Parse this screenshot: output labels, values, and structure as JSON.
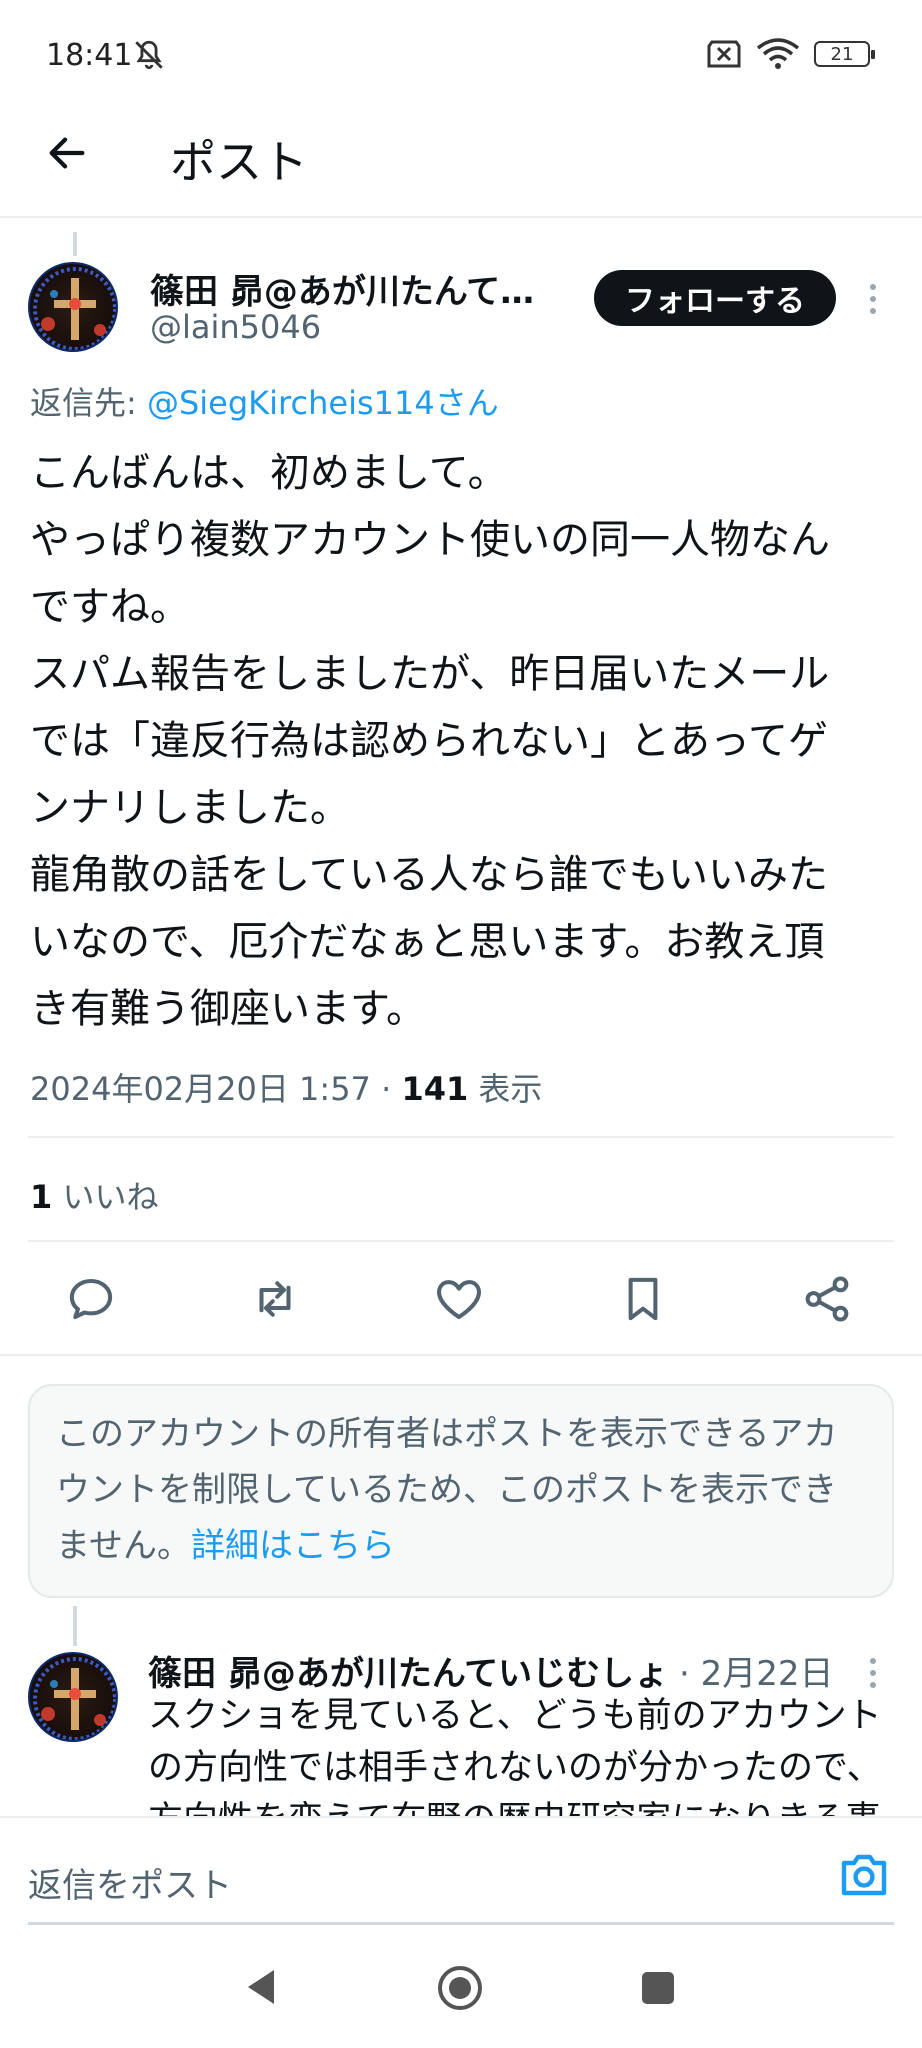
{
  "status_bar": {
    "time": "18:41",
    "battery": "21"
  },
  "header": {
    "title": "ポスト"
  },
  "post": {
    "display_name": "篠田 昴@あが川たんて…",
    "handle": "@lain5046",
    "follow_label": "フォローする",
    "reply_to_prefix": "返信先: ",
    "reply_to_target": "@SiegKircheis114さん",
    "body_lines": [
      "こんばんは、初めまして。",
      "やっぱり複数アカウント使いの同一人物なん",
      "ですね。",
      "スパム報告をしましたが、昨日届いたメール",
      "では「違反行為は認められない」とあってゲ",
      "ンナリしました。",
      "龍角散の話をしている人なら誰でもいいみた",
      "いなので、厄介だなぁと思います。お教え頂",
      "き有難う御座います。"
    ],
    "timestamp": "2024年02月20日 1:57",
    "separator": " · ",
    "views_count": "141",
    "views_label": " 表示",
    "likes_count": "1",
    "likes_label": " いいね"
  },
  "restricted_notice": {
    "text": "このアカウントの所有者はポストを表示できるアカウントを制限しているため、このポストを表示できません。",
    "link": "詳細はこちら"
  },
  "reply": {
    "display_name": "篠田 昴@あが川たんていじむしょ",
    "date": " · 2月22日",
    "lines": [
      "スクショを見ていると、どうも前のアカウント",
      "の方向性では相手されないのが分かったので、",
      "方向性を変えて在野の歴史研究家になりきる事"
    ]
  },
  "composer": {
    "placeholder": "返信をポスト"
  },
  "colors": {
    "accent": "#1d9bf0",
    "text": "#0f1419",
    "muted": "#536471"
  },
  "icons": [
    "bell-off-icon",
    "sim-off-icon",
    "wifi-icon",
    "battery-icon",
    "back-arrow-icon",
    "more-vert-icon",
    "reply-icon",
    "repost-icon",
    "like-icon",
    "bookmark-icon",
    "share-icon",
    "camera-icon",
    "nav-back-icon",
    "nav-home-icon",
    "nav-recents-icon"
  ]
}
